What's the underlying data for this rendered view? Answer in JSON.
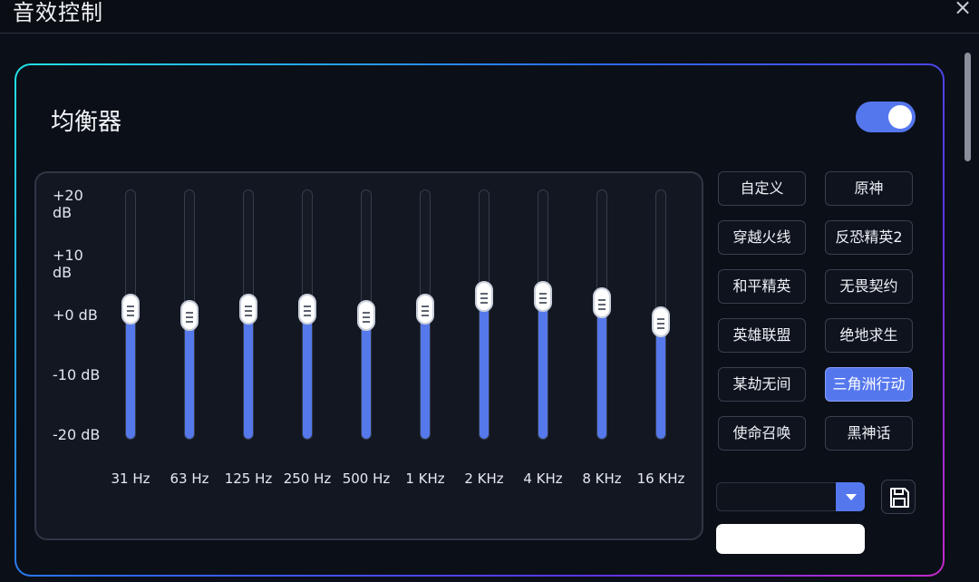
{
  "window": {
    "title": "音效控制",
    "close_symbol": "×"
  },
  "equalizer": {
    "title": "均衡器",
    "enabled": true,
    "db_labels": [
      "+20 dB",
      "+10 dB",
      "+0 dB",
      "-10 dB",
      "-20 dB"
    ],
    "bands": [
      {
        "label": "31 Hz",
        "gain_db": 1
      },
      {
        "label": "63 Hz",
        "gain_db": 0
      },
      {
        "label": "125 Hz",
        "gain_db": 1
      },
      {
        "label": "250 Hz",
        "gain_db": 1
      },
      {
        "label": "500 Hz",
        "gain_db": 0
      },
      {
        "label": "1 KHz",
        "gain_db": 1
      },
      {
        "label": "2 KHz",
        "gain_db": 3
      },
      {
        "label": "4 KHz",
        "gain_db": 3
      },
      {
        "label": "8 KHz",
        "gain_db": 2
      },
      {
        "label": "16 KHz",
        "gain_db": -1
      }
    ]
  },
  "presets": {
    "items": [
      "自定义",
      "原神",
      "穿越火线",
      "反恐精英2",
      "和平精英",
      "无畏契约",
      "英雄联盟",
      "绝地求生",
      "某劫无间",
      "三角洲行动",
      "使命召唤",
      "黑神话"
    ],
    "active": "三角洲行动"
  },
  "preset_select": {
    "value": ""
  },
  "preset_name_input": {
    "value": ""
  },
  "colors": {
    "accent": "#5577ee",
    "border_start": "#21e3e6",
    "border_end": "#c529c8"
  },
  "icons": {
    "save": "save-icon",
    "close": "close-icon",
    "dropdown": "chevron-down-icon"
  }
}
